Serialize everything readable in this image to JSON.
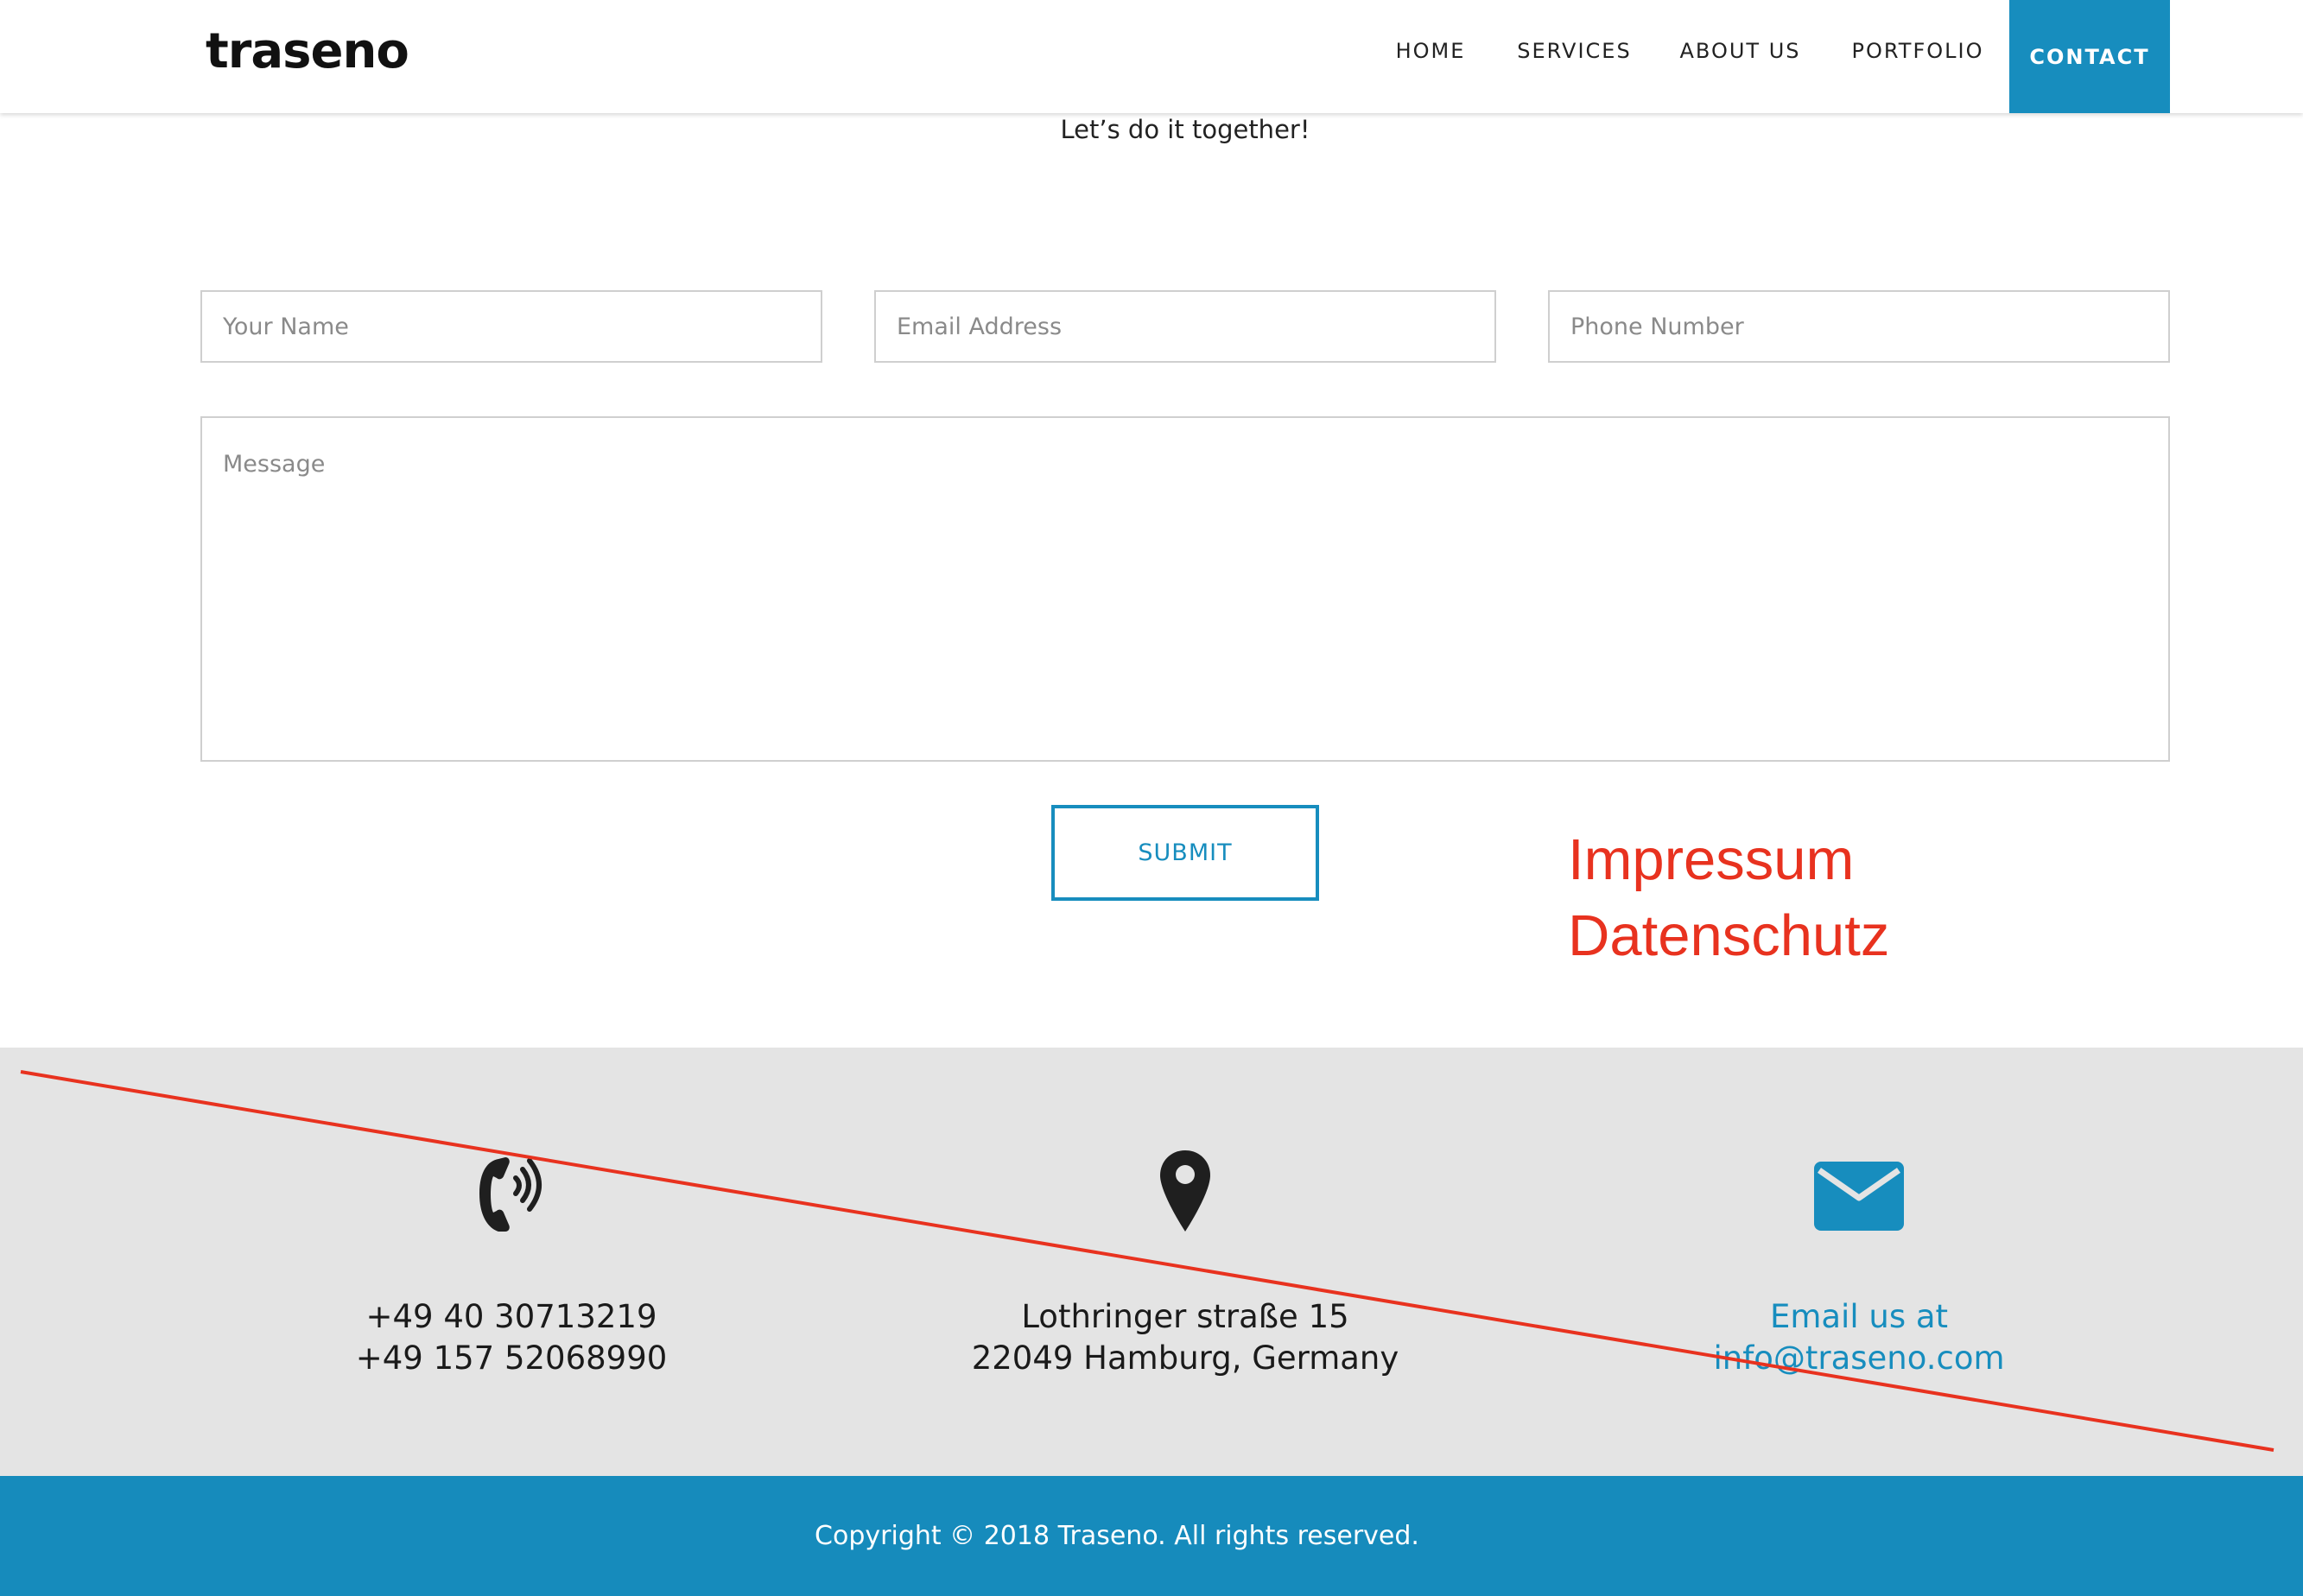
{
  "header": {
    "logo": "traseno",
    "nav": [
      {
        "label": "HOME"
      },
      {
        "label": "SERVICES"
      },
      {
        "label": "ABOUT US"
      },
      {
        "label": "PORTFOLIO"
      },
      {
        "label": "CONTACT",
        "active": true
      }
    ]
  },
  "intro": {
    "text": "Let’s do it together!"
  },
  "form": {
    "name_placeholder": "Your Name",
    "email_placeholder": "Email Address",
    "phone_placeholder": "Phone Number",
    "message_placeholder": "Message",
    "submit_label": "SUBMIT"
  },
  "legal_links": {
    "impressum": "Impressum",
    "datenschutz": "Datenschutz"
  },
  "contact_info": {
    "phone": {
      "icon": "phone-icon",
      "lines": [
        "+49 40 30713219",
        "+49 157 52068990"
      ]
    },
    "address": {
      "icon": "map-pin-icon",
      "lines": [
        "Lothringer straße 15",
        "22049 Hamburg, Germany"
      ]
    },
    "email": {
      "icon": "envelope-icon",
      "lines": [
        "Email us at",
        "info@traseno.com"
      ]
    }
  },
  "footer": {
    "copyright": "Copyright © 2018 Traseno. All rights reserved."
  },
  "colors": {
    "brand_blue": "#178dbe",
    "annotation_red": "#e8321f",
    "info_band_bg": "#e4e4e4"
  }
}
